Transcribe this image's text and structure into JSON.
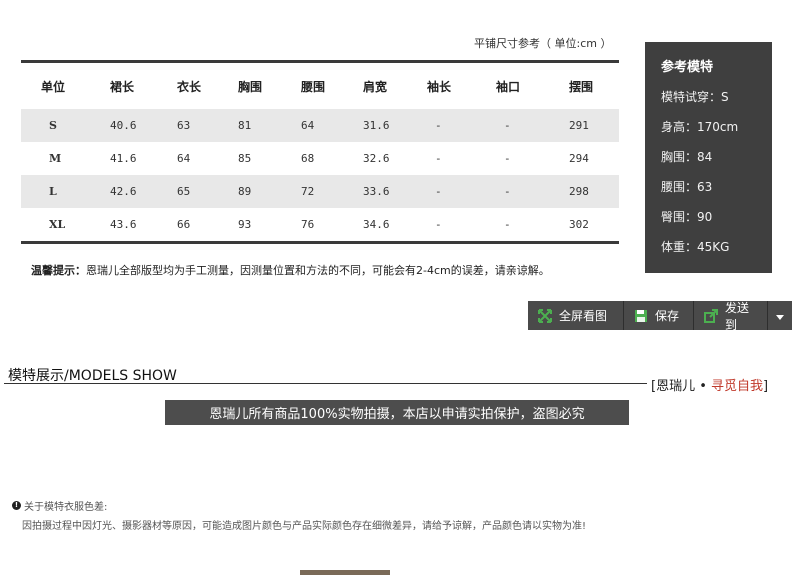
{
  "caption": "平铺尺寸参考（ 单位:cm ）",
  "table": {
    "headers": [
      "单位",
      "裙长",
      "衣长",
      "胸围",
      "腰围",
      "肩宽",
      "袖长",
      "袖口",
      "摆围"
    ],
    "rows": [
      [
        "S",
        "40.6",
        "63",
        "81",
        "64",
        "31.6",
        "-",
        "-",
        "291"
      ],
      [
        "M",
        "41.6",
        "64",
        "85",
        "68",
        "32.6",
        "-",
        "-",
        "294"
      ],
      [
        "L",
        "42.6",
        "65",
        "89",
        "72",
        "33.6",
        "-",
        "-",
        "298"
      ],
      [
        "XL",
        "43.6",
        "66",
        "93",
        "76",
        "34.6",
        "-",
        "-",
        "302"
      ]
    ]
  },
  "tip": {
    "label": "温馨提示：",
    "text": "恩瑞儿全部版型均为手工测量，因测量位置和方法的不同，可能会有2-4cm的误差，请亲谅解。"
  },
  "model": {
    "title": "参考模特",
    "rows": [
      "模特试穿：S",
      "身高：170cm",
      "胸围：84",
      "腰围：63",
      "臀围：90",
      "体重：45KG"
    ]
  },
  "toolbar": {
    "fullscreen": "全屏看图",
    "save": "保存",
    "send": "发送到"
  },
  "section": {
    "title": "模特展示/MODELS SHOW",
    "brand_open": "[恩瑞儿",
    "brand_dot": " • ",
    "brand_highlight": "寻觅自我",
    "brand_close": "]"
  },
  "banner": "恩瑞儿所有商品100%实物拍摄，本店以申请实拍保护，盗图必究",
  "note": {
    "title": "关于模特衣服色差:",
    "body": "因拍摄过程中因灯光、摄影器材等原因，可能造成图片颜色与产品实际颜色存在细微差异，请给予谅解，产品颜色请以实物为准!"
  },
  "colors": {
    "dark_panel": "#3f3f3f",
    "row_shade": "#e8e8e8",
    "brand_accent": "#c0392b",
    "icon_green": "#4caf50"
  }
}
